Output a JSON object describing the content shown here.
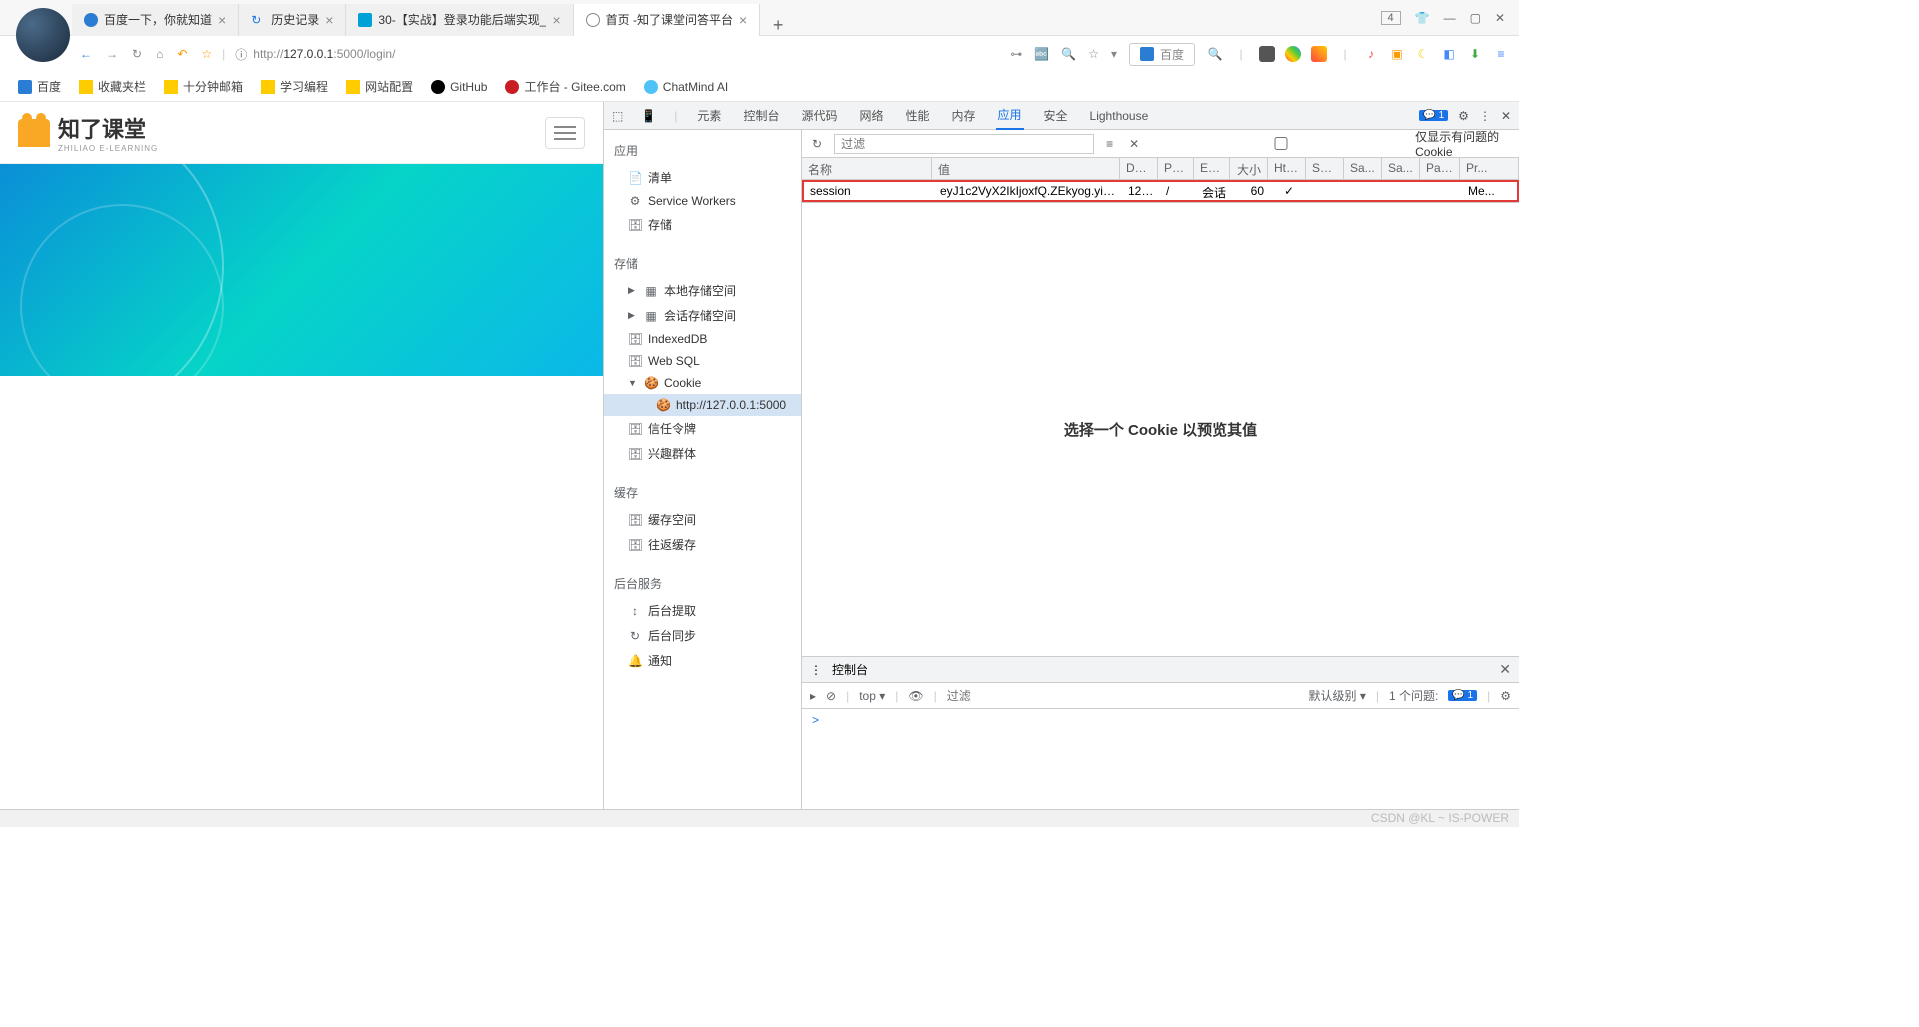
{
  "browser": {
    "tabs": [
      {
        "title": "百度一下，你就知道",
        "icon": "baidu"
      },
      {
        "title": "历史记录",
        "icon": "clock"
      },
      {
        "title": "30-【实战】登录功能后端实现_",
        "icon": "bilibili"
      },
      {
        "title": "首页 -知了课堂问答平台",
        "icon": "globe",
        "active": true
      }
    ],
    "window_badge": "4",
    "url_prefix": "http://",
    "url_host": "127.0.0.1",
    "url_port_path": ":5000/login/",
    "search_engine": "百度"
  },
  "bookmarks": [
    {
      "label": "百度",
      "icon": "baidu"
    },
    {
      "label": "收藏夹栏",
      "icon": "folder"
    },
    {
      "label": "十分钟邮箱",
      "icon": "folder"
    },
    {
      "label": "学习编程",
      "icon": "folder"
    },
    {
      "label": "网站配置",
      "icon": "folder"
    },
    {
      "label": "GitHub",
      "icon": "github"
    },
    {
      "label": "工作台 - Gitee.com",
      "icon": "gitee"
    },
    {
      "label": "ChatMind AI",
      "icon": "chatmind"
    }
  ],
  "page": {
    "logo_text": "知了课堂",
    "logo_sub": "ZHILIAO E-LEARNING"
  },
  "devtools": {
    "tabs": [
      "元素",
      "控制台",
      "源代码",
      "网络",
      "性能",
      "内存",
      "应用",
      "安全",
      "Lighthouse"
    ],
    "active_tab": "应用",
    "msg_count": "1",
    "sidebar": {
      "app_title": "应用",
      "app_items": [
        "清单",
        "Service Workers",
        "存储"
      ],
      "storage_title": "存储",
      "storage_items": [
        "本地存储空间",
        "会话存储空间",
        "IndexedDB",
        "Web SQL"
      ],
      "cookie_label": "Cookie",
      "cookie_url": "http://127.0.0.1:5000",
      "trust_label": "信任令牌",
      "interest_label": "兴趣群体",
      "cache_title": "缓存",
      "cache_items": [
        "缓存空间",
        "往返缓存"
      ],
      "bg_title": "后台服务",
      "bg_items": [
        "后台提取",
        "后台同步",
        "通知"
      ]
    },
    "filter": {
      "placeholder": "过滤",
      "only_issues": "仅显示有问题的 Cookie"
    },
    "cookie_headers": {
      "name": "名称",
      "value": "值",
      "domain": "Do...",
      "path": "Path",
      "expires": "Exp...",
      "size": "大小",
      "http": "Htt...",
      "secure": "Sec...",
      "same": "Sa...",
      "same2": "Sa...",
      "part": "Part...",
      "pr": "Pr..."
    },
    "cookie_row": {
      "name": "session",
      "value": "eyJ1c2VyX2IkIjoxfQ.ZEkyog.yiJW...",
      "domain": "127...",
      "path": "/",
      "expires": "会话",
      "size": "60",
      "http": "✓",
      "secure": "",
      "same": "",
      "same2": "",
      "part": "",
      "pr": "Me..."
    },
    "preview_text": "选择一个 Cookie 以预览其值"
  },
  "console": {
    "title": "控制台",
    "scope": "top ▾",
    "filter_placeholder": "过滤",
    "level": "默认级别 ▾",
    "issues_label": "1 个问题:",
    "issues_count": "1",
    "prompt": ">"
  },
  "watermark": "CSDN @KL ~ IS-POWER"
}
